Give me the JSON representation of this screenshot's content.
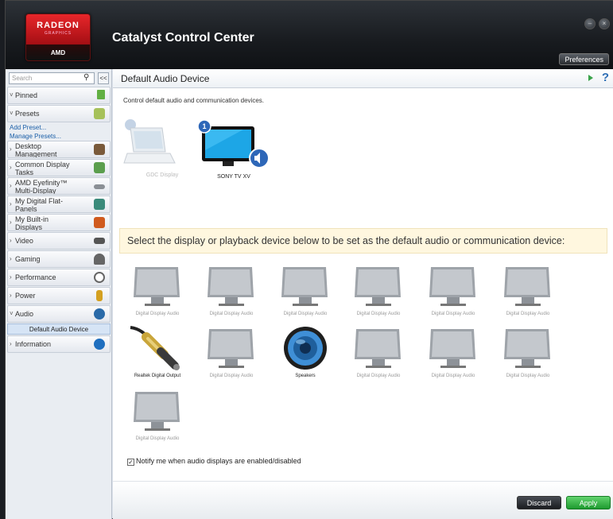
{
  "window": {
    "logo": {
      "line1": "RADEON",
      "line2": "GRAPHICS",
      "line3": "AMD"
    },
    "title": "Catalyst Control Center",
    "preferences_label": "Preferences"
  },
  "sidebar": {
    "search_placeholder": "Search",
    "collapse_label": "<<",
    "items": [
      {
        "label": "Pinned",
        "caret": "v",
        "icon_color": "#62b043"
      },
      {
        "label": "Presets",
        "caret": "v",
        "icon_color": "#a6c15a"
      }
    ],
    "links": [
      "Add Preset...",
      "Manage Presets..."
    ],
    "sections": [
      {
        "label": "Desktop Management",
        "l1": "Desktop",
        "l2": "Management",
        "icon_color": "#7a5a3a"
      },
      {
        "label": "Common Display Tasks",
        "l1": "Common Display",
        "l2": "Tasks",
        "icon_color": "#5b9e4d"
      },
      {
        "label": "AMD Eyefinity™ Multi-Display",
        "l1": "AMD Eyefinity™",
        "l2": "Multi-Display",
        "icon_color": "#8a8f95"
      },
      {
        "label": "My Digital Flat-Panels",
        "l1": "My Digital Flat-",
        "l2": "Panels",
        "icon_color": "#3a8a7a"
      },
      {
        "label": "My Built-in Displays",
        "l1": "My Built-in",
        "l2": "Displays",
        "icon_color": "#d05a1e"
      }
    ],
    "single": [
      {
        "label": "Video",
        "icon_color": "#555"
      },
      {
        "label": "Gaming",
        "icon_color": "#666"
      },
      {
        "label": "Performance",
        "icon_color": "#888"
      },
      {
        "label": "Power",
        "icon_color": "#d4a020"
      }
    ],
    "audio": {
      "label": "Audio",
      "caret": "v",
      "icon_color": "#2a6aa8",
      "sub": "Default Audio Device"
    },
    "information": {
      "label": "Information",
      "icon_color": "#1f6fbf"
    }
  },
  "main": {
    "title": "Default Audio Device",
    "help": "?",
    "description": "Control default audio and communication devices.",
    "current_devices": [
      {
        "name": "GDC Display",
        "state": "disabled"
      },
      {
        "name": "SONY TV XV",
        "badge": "1",
        "state": "default"
      }
    ],
    "prompt": "Select the display or playback device below to be set as the default audio or communication device:",
    "devices": [
      {
        "name": "Digital Display Audio",
        "kind": "monitor"
      },
      {
        "name": "Digital Display Audio",
        "kind": "monitor"
      },
      {
        "name": "Digital Display Audio",
        "kind": "monitor"
      },
      {
        "name": "Digital Display Audio",
        "kind": "monitor"
      },
      {
        "name": "Digital Display Audio",
        "kind": "monitor"
      },
      {
        "name": "Digital Display Audio",
        "kind": "monitor"
      },
      {
        "name": "Realtek Digital Output",
        "kind": "cable"
      },
      {
        "name": "Digital Display Audio",
        "kind": "monitor"
      },
      {
        "name": "Speakers",
        "kind": "speaker"
      },
      {
        "name": "Digital Display Audio",
        "kind": "monitor"
      },
      {
        "name": "Digital Display Audio",
        "kind": "monitor"
      },
      {
        "name": "Digital Display Audio",
        "kind": "monitor"
      },
      {
        "name": "Digital Display Audio",
        "kind": "monitor"
      }
    ],
    "notify_label": "Notify me when audio displays are enabled/disabled",
    "notify_checked": true,
    "discard_label": "Discard",
    "apply_label": "Apply"
  }
}
